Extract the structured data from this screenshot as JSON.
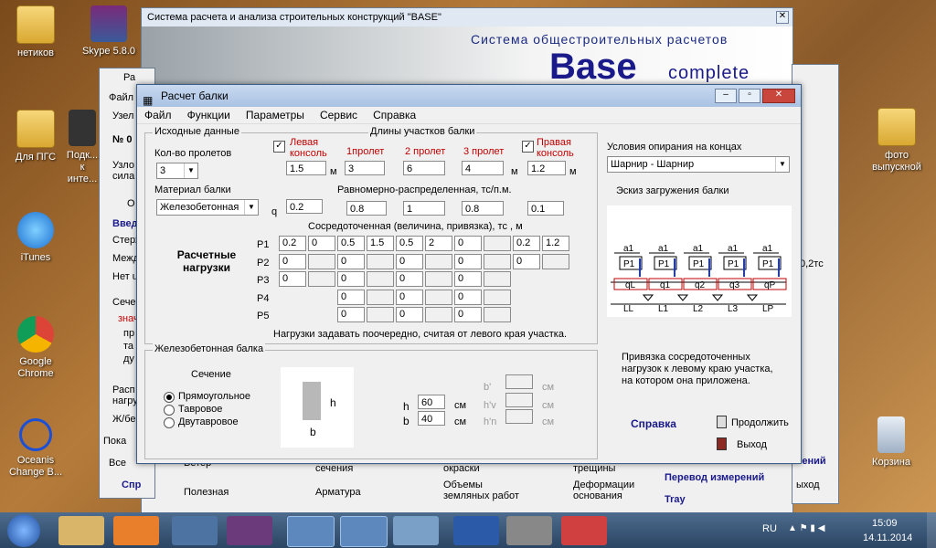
{
  "desktop": {
    "icons": [
      {
        "label": "нетиков"
      },
      {
        "label": "Skype 5.8.0"
      },
      {
        "label": "Для ПГС"
      },
      {
        "label": "Подк... к инте..."
      },
      {
        "label": "iTunes"
      },
      {
        "label": "Google Chrome"
      },
      {
        "label": "Oceanis Change B..."
      },
      {
        "label": "фото выпускной"
      },
      {
        "label": "Корзина"
      }
    ]
  },
  "base_window": {
    "title": "Система расчета и анализа строительных конструкций  \"BASE\"",
    "banner_sub": "Система общестроительных расчетов",
    "banner_brand": "Base",
    "banner_brand2": "complete"
  },
  "dialog": {
    "title": "Расчет балки",
    "menu": [
      "Файл",
      "Функции",
      "Параметры",
      "Сервис",
      "Справка"
    ],
    "initial_group": "Исходные данные",
    "spans_label": "Кол-во пролетов",
    "spans_value": "3",
    "material_label": "Материал балки",
    "material_value": "Железобетонная",
    "lengths_label": "Длины участков балки",
    "left_console": "Левая консоль",
    "right_console": "Правая консоль",
    "span1": "1пролет",
    "span2": "2 пролет",
    "span3": "3 пролет",
    "unit_m": "м",
    "lengths": [
      "1.5",
      "3",
      "6",
      "4",
      "1.2"
    ],
    "uniform_label": "Равномерно-распределенная,  тс/п.м.",
    "q_label": "q",
    "uniform": [
      "0.2",
      "0.8",
      "1",
      "0.8",
      "0.1"
    ],
    "concentrated_label": "Сосредоточенная (величина, привязка),  тс  , м",
    "design_loads": "Расчетные нагрузки",
    "p_labels": [
      "P1",
      "P2",
      "P3",
      "P4",
      "P5"
    ],
    "p_rows": [
      [
        "0.2",
        "0",
        "0.5",
        "1.5",
        "0.5",
        "2",
        "0",
        "",
        "0.2",
        "1.2"
      ],
      [
        "0",
        "",
        "0",
        "",
        "0",
        "",
        "0",
        "",
        "0",
        ""
      ],
      [
        "0",
        "",
        "0",
        "",
        "0",
        "",
        "0",
        "",
        "",
        ""
      ],
      [
        "",
        "",
        "0",
        "",
        "0",
        "",
        "0",
        "",
        "",
        ""
      ],
      [
        "",
        "",
        "0",
        "",
        "0",
        "",
        "0",
        "",
        "",
        ""
      ]
    ],
    "loads_note": "Нагрузки задавать поочередно, считая от левого края участка.",
    "rc_group": "Железобетонная балка",
    "section_label": "Сечение",
    "section_options": [
      "Прямоугольное",
      "Тавровое",
      "Двутавровое"
    ],
    "h_label": "h",
    "h_value": "60",
    "b_label": "b",
    "b_value": "40",
    "unit_cm": "см",
    "bprime": "b'",
    "hprime_v": "h'v",
    "hprime_n": "h'n",
    "support_label": "Условия опирания на концах",
    "support_value": "Шарнир - Шарнир",
    "sketch_label": "Эскиз загружения балки",
    "binding_note": "Привязка сосредоточенных нагрузок к левому краю участка, на котором она приложена.",
    "help_btn": "Справка",
    "continue_btn": "Продолжить",
    "exit_btn": "Выход",
    "sketch": {
      "a_labels": [
        "a1",
        "a1",
        "a1",
        "a1",
        "a1"
      ],
      "p_labels": [
        "P1",
        "P1",
        "P1",
        "P1",
        "P1"
      ],
      "q_labels": [
        "qL",
        "q1",
        "q2",
        "q3",
        "qP"
      ],
      "spans": [
        "LL",
        "L1",
        "L2",
        "L3",
        "LP"
      ]
    }
  },
  "background_items": [
    "Ветер",
    "Полезная",
    "сечения",
    "Арматура",
    "окраски",
    "Объемы земляных работ",
    "трещины",
    "Деформации основания",
    "Перевод измерений",
    "Tray",
    "чений",
    "ыход",
    "0,2тс",
    "Все",
    "Спр"
  ],
  "left_window": {
    "lines": [
      "Ра",
      "Файл",
      "Узел",
      "№ 0",
      "Узло",
      "сила",
      "О",
      "Введ",
      "Стерж",
      "Межд",
      "Нет u",
      "Сечен",
      "знач",
      "пр",
      "та",
      "ду",
      "Расп",
      "нагру",
      "Ж/бе",
      "Пока"
    ]
  },
  "taskbar": {
    "lang": "RU",
    "time": "15:09",
    "date": "14.11.2014"
  }
}
